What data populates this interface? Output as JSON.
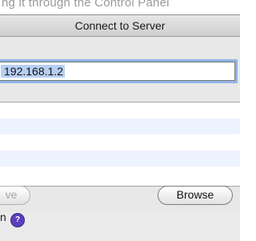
{
  "background": {
    "top_text": "ng it through the Control Panel",
    "bottom_text": "n",
    "help_badge": "?"
  },
  "dialog": {
    "title": "Connect to Server",
    "address_field": {
      "value": "192.168.1.2"
    },
    "buttons": {
      "remove_label": "ve",
      "browse_label": "Browse"
    }
  },
  "colors": {
    "selection": "#b7d0f2",
    "focus_ring": "#8fb3e6",
    "list_alt_row": "#edf3fe"
  }
}
